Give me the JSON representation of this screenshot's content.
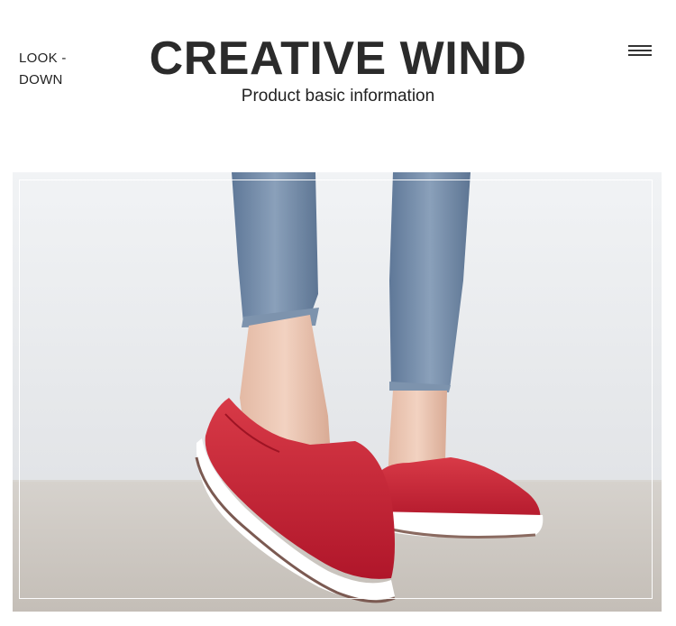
{
  "header": {
    "left_line1": "LOOK -",
    "left_line2": "DOWN",
    "title": "CREATIVE WIND",
    "subtitle": "Product basic information",
    "menu_icon": "hamburger-menu-icon"
  },
  "colors": {
    "shoe": "#c9202f",
    "sole": "#ffffff",
    "jeans": "#6f87a3",
    "wall": "#eceef1",
    "floor": "#cbc6c0"
  }
}
